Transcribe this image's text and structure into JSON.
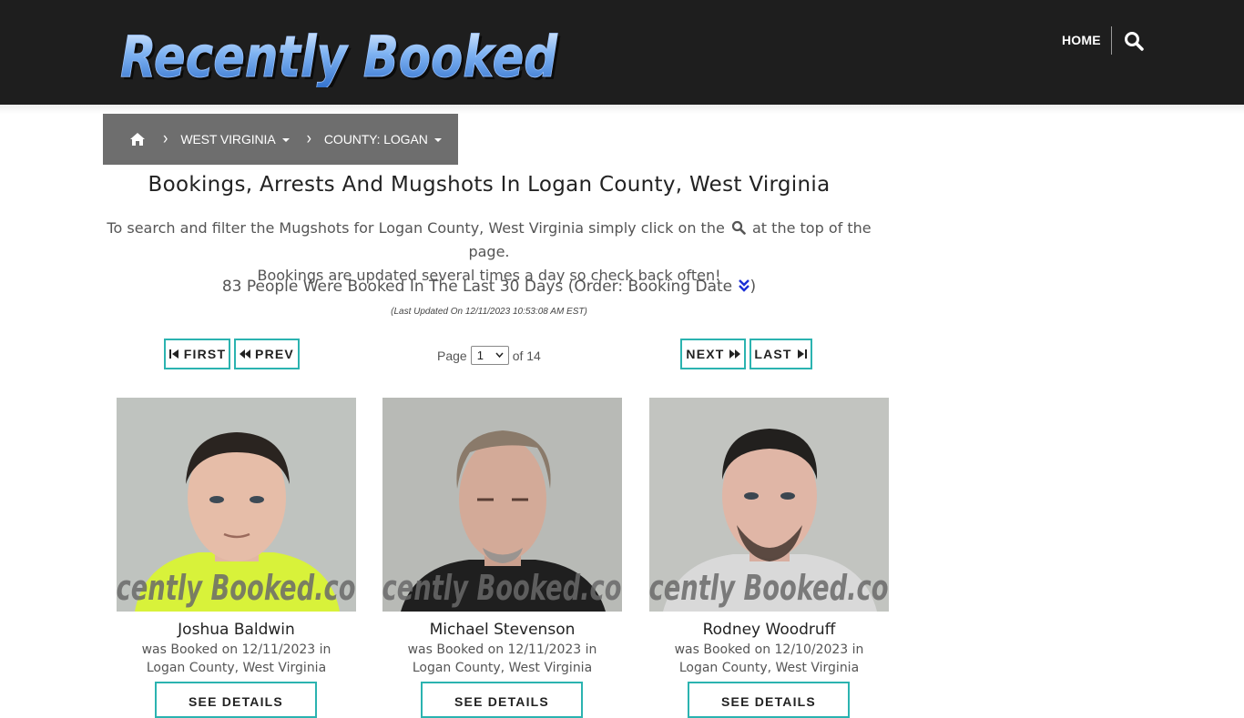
{
  "header": {
    "logo_text": "Recently Booked",
    "nav_home": "HOME",
    "search_icon": "search-icon"
  },
  "breadcrumb": {
    "home_icon": "home-icon",
    "state": "WEST VIRGINIA",
    "county": "COUNTY: LOGAN"
  },
  "main": {
    "title": "Bookings, Arrests And Mugshots In Logan County, West Virginia",
    "intro_before": "To search and filter the Mugshots for Logan County, West Virginia simply click on the",
    "intro_after": "at the top of the page.",
    "intro_line2": "Bookings are updated several times a day so check back often!",
    "count_text": "83 People Were Booked In The Last 30 Days (Order: Booking Date",
    "count_close": ")",
    "updated": "(Last Updated On 12/11/2023 10:53:08 AM EST)"
  },
  "pager": {
    "first": "FIRST",
    "prev": "PREV",
    "next": "NEXT",
    "last": "LAST",
    "page_label": "Page",
    "current_page": "1",
    "of_label": "of 14"
  },
  "cards": [
    {
      "name": "Joshua Baldwin",
      "booked_line": "was Booked on 12/11/2023 in",
      "location": "Logan County, West Virginia",
      "button": "SEE DETAILS",
      "watermark": "cently Booked.co"
    },
    {
      "name": "Michael Stevenson",
      "booked_line": "was Booked on 12/11/2023 in",
      "location": "Logan County, West Virginia",
      "button": "SEE DETAILS",
      "watermark": "cently Booked.co"
    },
    {
      "name": "Rodney Woodruff",
      "booked_line": "was Booked on 12/10/2023 in",
      "location": "Logan County, West Virginia",
      "button": "SEE DETAILS",
      "watermark": "cently Booked.co"
    }
  ],
  "colors": {
    "header_bg": "#1e1e1e",
    "breadcrumb_bg": "#6e6e6e",
    "accent_teal": "#2bb3b0",
    "logo_blue": "#6aa6f0"
  }
}
